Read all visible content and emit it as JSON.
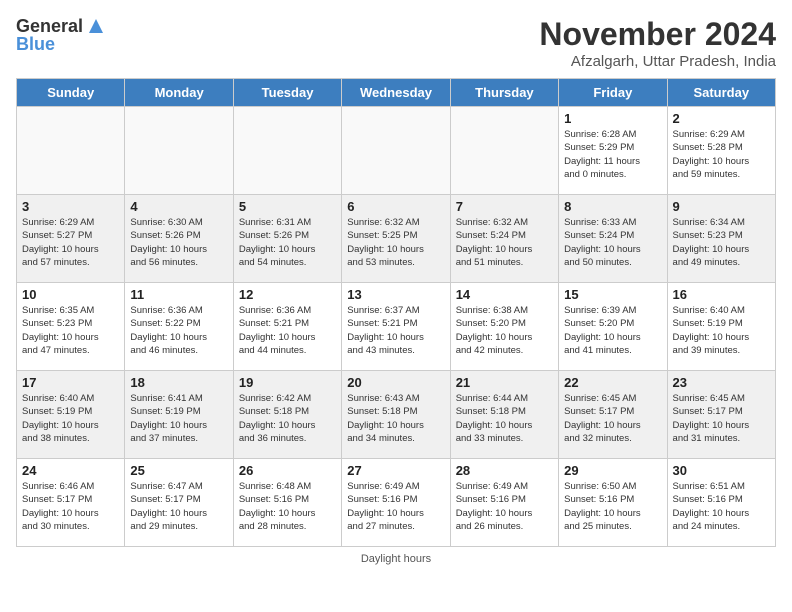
{
  "header": {
    "logo_general": "General",
    "logo_blue": "Blue",
    "title": "November 2024",
    "subtitle": "Afzalgarh, Uttar Pradesh, India"
  },
  "days_of_week": [
    "Sunday",
    "Monday",
    "Tuesday",
    "Wednesday",
    "Thursday",
    "Friday",
    "Saturday"
  ],
  "footer": {
    "daylight_note": "Daylight hours"
  },
  "weeks": [
    [
      {
        "day": "",
        "info": ""
      },
      {
        "day": "",
        "info": ""
      },
      {
        "day": "",
        "info": ""
      },
      {
        "day": "",
        "info": ""
      },
      {
        "day": "",
        "info": ""
      },
      {
        "day": "1",
        "info": "Sunrise: 6:28 AM\nSunset: 5:29 PM\nDaylight: 11 hours\nand 0 minutes."
      },
      {
        "day": "2",
        "info": "Sunrise: 6:29 AM\nSunset: 5:28 PM\nDaylight: 10 hours\nand 59 minutes."
      }
    ],
    [
      {
        "day": "3",
        "info": "Sunrise: 6:29 AM\nSunset: 5:27 PM\nDaylight: 10 hours\nand 57 minutes."
      },
      {
        "day": "4",
        "info": "Sunrise: 6:30 AM\nSunset: 5:26 PM\nDaylight: 10 hours\nand 56 minutes."
      },
      {
        "day": "5",
        "info": "Sunrise: 6:31 AM\nSunset: 5:26 PM\nDaylight: 10 hours\nand 54 minutes."
      },
      {
        "day": "6",
        "info": "Sunrise: 6:32 AM\nSunset: 5:25 PM\nDaylight: 10 hours\nand 53 minutes."
      },
      {
        "day": "7",
        "info": "Sunrise: 6:32 AM\nSunset: 5:24 PM\nDaylight: 10 hours\nand 51 minutes."
      },
      {
        "day": "8",
        "info": "Sunrise: 6:33 AM\nSunset: 5:24 PM\nDaylight: 10 hours\nand 50 minutes."
      },
      {
        "day": "9",
        "info": "Sunrise: 6:34 AM\nSunset: 5:23 PM\nDaylight: 10 hours\nand 49 minutes."
      }
    ],
    [
      {
        "day": "10",
        "info": "Sunrise: 6:35 AM\nSunset: 5:23 PM\nDaylight: 10 hours\nand 47 minutes."
      },
      {
        "day": "11",
        "info": "Sunrise: 6:36 AM\nSunset: 5:22 PM\nDaylight: 10 hours\nand 46 minutes."
      },
      {
        "day": "12",
        "info": "Sunrise: 6:36 AM\nSunset: 5:21 PM\nDaylight: 10 hours\nand 44 minutes."
      },
      {
        "day": "13",
        "info": "Sunrise: 6:37 AM\nSunset: 5:21 PM\nDaylight: 10 hours\nand 43 minutes."
      },
      {
        "day": "14",
        "info": "Sunrise: 6:38 AM\nSunset: 5:20 PM\nDaylight: 10 hours\nand 42 minutes."
      },
      {
        "day": "15",
        "info": "Sunrise: 6:39 AM\nSunset: 5:20 PM\nDaylight: 10 hours\nand 41 minutes."
      },
      {
        "day": "16",
        "info": "Sunrise: 6:40 AM\nSunset: 5:19 PM\nDaylight: 10 hours\nand 39 minutes."
      }
    ],
    [
      {
        "day": "17",
        "info": "Sunrise: 6:40 AM\nSunset: 5:19 PM\nDaylight: 10 hours\nand 38 minutes."
      },
      {
        "day": "18",
        "info": "Sunrise: 6:41 AM\nSunset: 5:19 PM\nDaylight: 10 hours\nand 37 minutes."
      },
      {
        "day": "19",
        "info": "Sunrise: 6:42 AM\nSunset: 5:18 PM\nDaylight: 10 hours\nand 36 minutes."
      },
      {
        "day": "20",
        "info": "Sunrise: 6:43 AM\nSunset: 5:18 PM\nDaylight: 10 hours\nand 34 minutes."
      },
      {
        "day": "21",
        "info": "Sunrise: 6:44 AM\nSunset: 5:18 PM\nDaylight: 10 hours\nand 33 minutes."
      },
      {
        "day": "22",
        "info": "Sunrise: 6:45 AM\nSunset: 5:17 PM\nDaylight: 10 hours\nand 32 minutes."
      },
      {
        "day": "23",
        "info": "Sunrise: 6:45 AM\nSunset: 5:17 PM\nDaylight: 10 hours\nand 31 minutes."
      }
    ],
    [
      {
        "day": "24",
        "info": "Sunrise: 6:46 AM\nSunset: 5:17 PM\nDaylight: 10 hours\nand 30 minutes."
      },
      {
        "day": "25",
        "info": "Sunrise: 6:47 AM\nSunset: 5:17 PM\nDaylight: 10 hours\nand 29 minutes."
      },
      {
        "day": "26",
        "info": "Sunrise: 6:48 AM\nSunset: 5:16 PM\nDaylight: 10 hours\nand 28 minutes."
      },
      {
        "day": "27",
        "info": "Sunrise: 6:49 AM\nSunset: 5:16 PM\nDaylight: 10 hours\nand 27 minutes."
      },
      {
        "day": "28",
        "info": "Sunrise: 6:49 AM\nSunset: 5:16 PM\nDaylight: 10 hours\nand 26 minutes."
      },
      {
        "day": "29",
        "info": "Sunrise: 6:50 AM\nSunset: 5:16 PM\nDaylight: 10 hours\nand 25 minutes."
      },
      {
        "day": "30",
        "info": "Sunrise: 6:51 AM\nSunset: 5:16 PM\nDaylight: 10 hours\nand 24 minutes."
      }
    ]
  ]
}
